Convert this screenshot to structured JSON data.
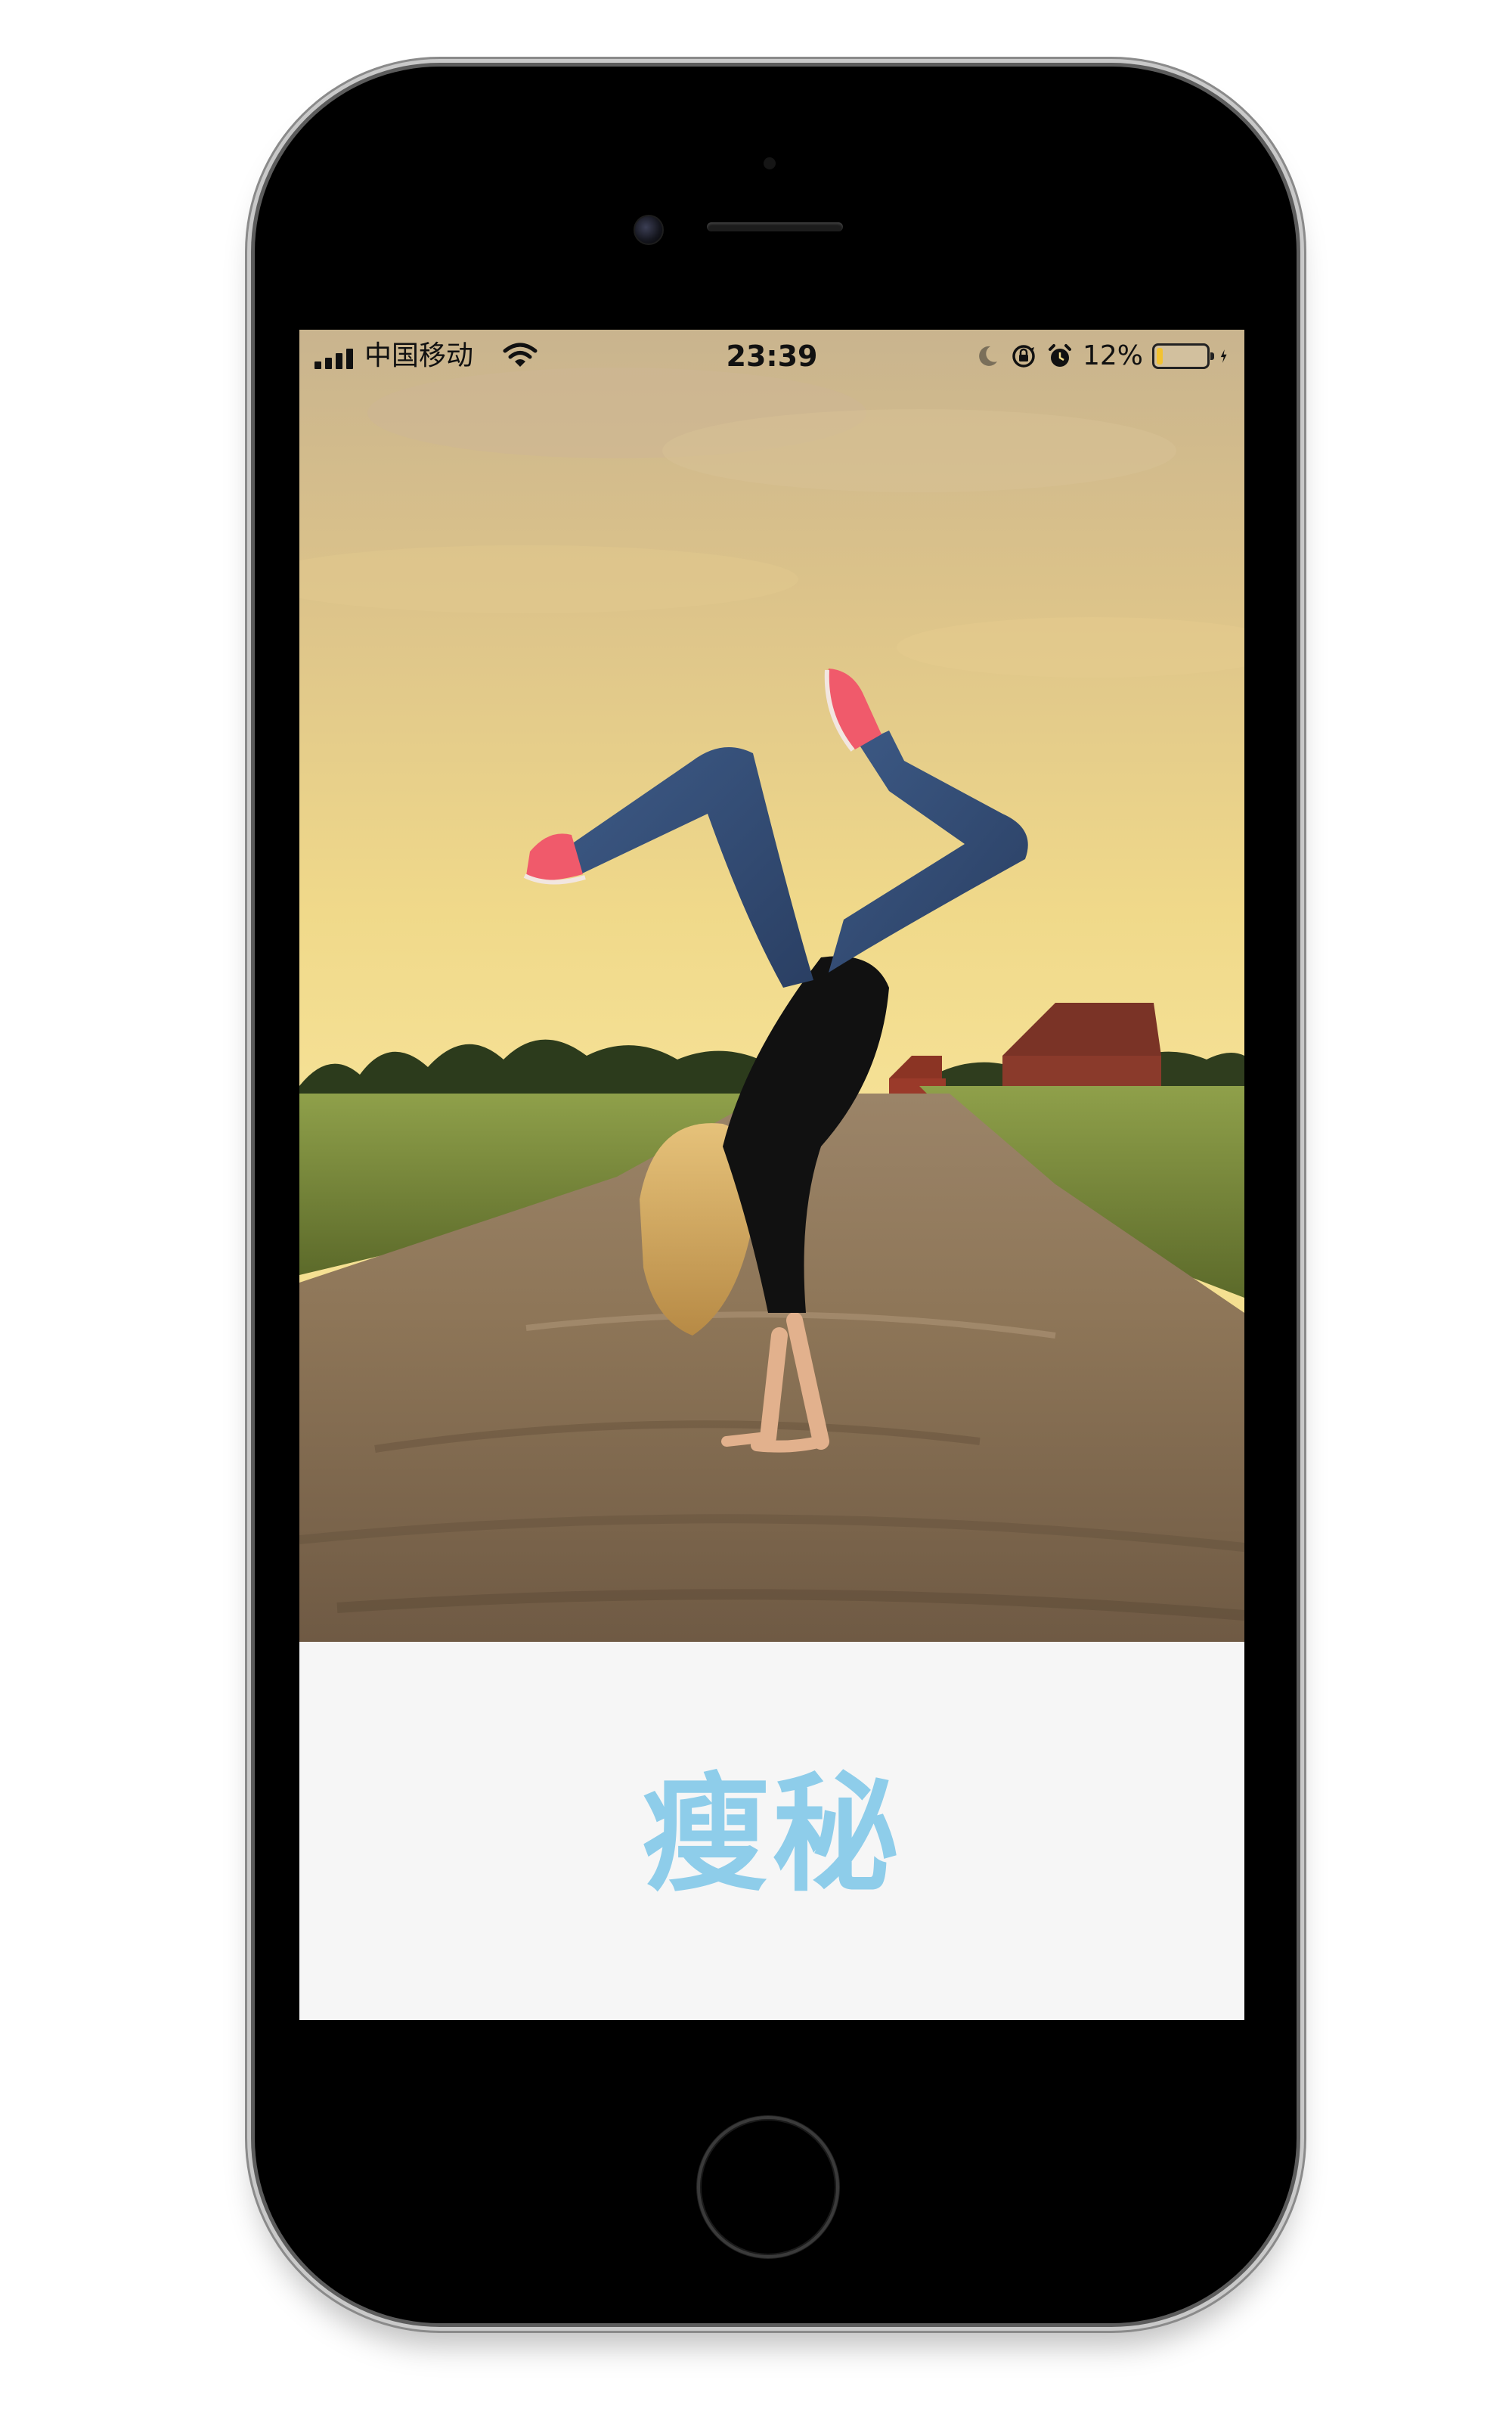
{
  "status_bar": {
    "carrier": "中国移动",
    "time": "23:39",
    "battery_percent": "12%",
    "battery_level": 0.12,
    "battery_color": "#f2c230",
    "icons": [
      "signal-icon",
      "wifi-icon",
      "moon-icon",
      "rotation-lock-icon",
      "alarm-icon",
      "battery-icon",
      "charging-bolt-icon"
    ]
  },
  "hero": {
    "image": "woman doing a handstand on a gravel country road at sunset"
  },
  "brand": {
    "title": "瘦秘",
    "color": "#8ecdea"
  },
  "device": {
    "model": "phone-frame",
    "color": "#000000"
  }
}
